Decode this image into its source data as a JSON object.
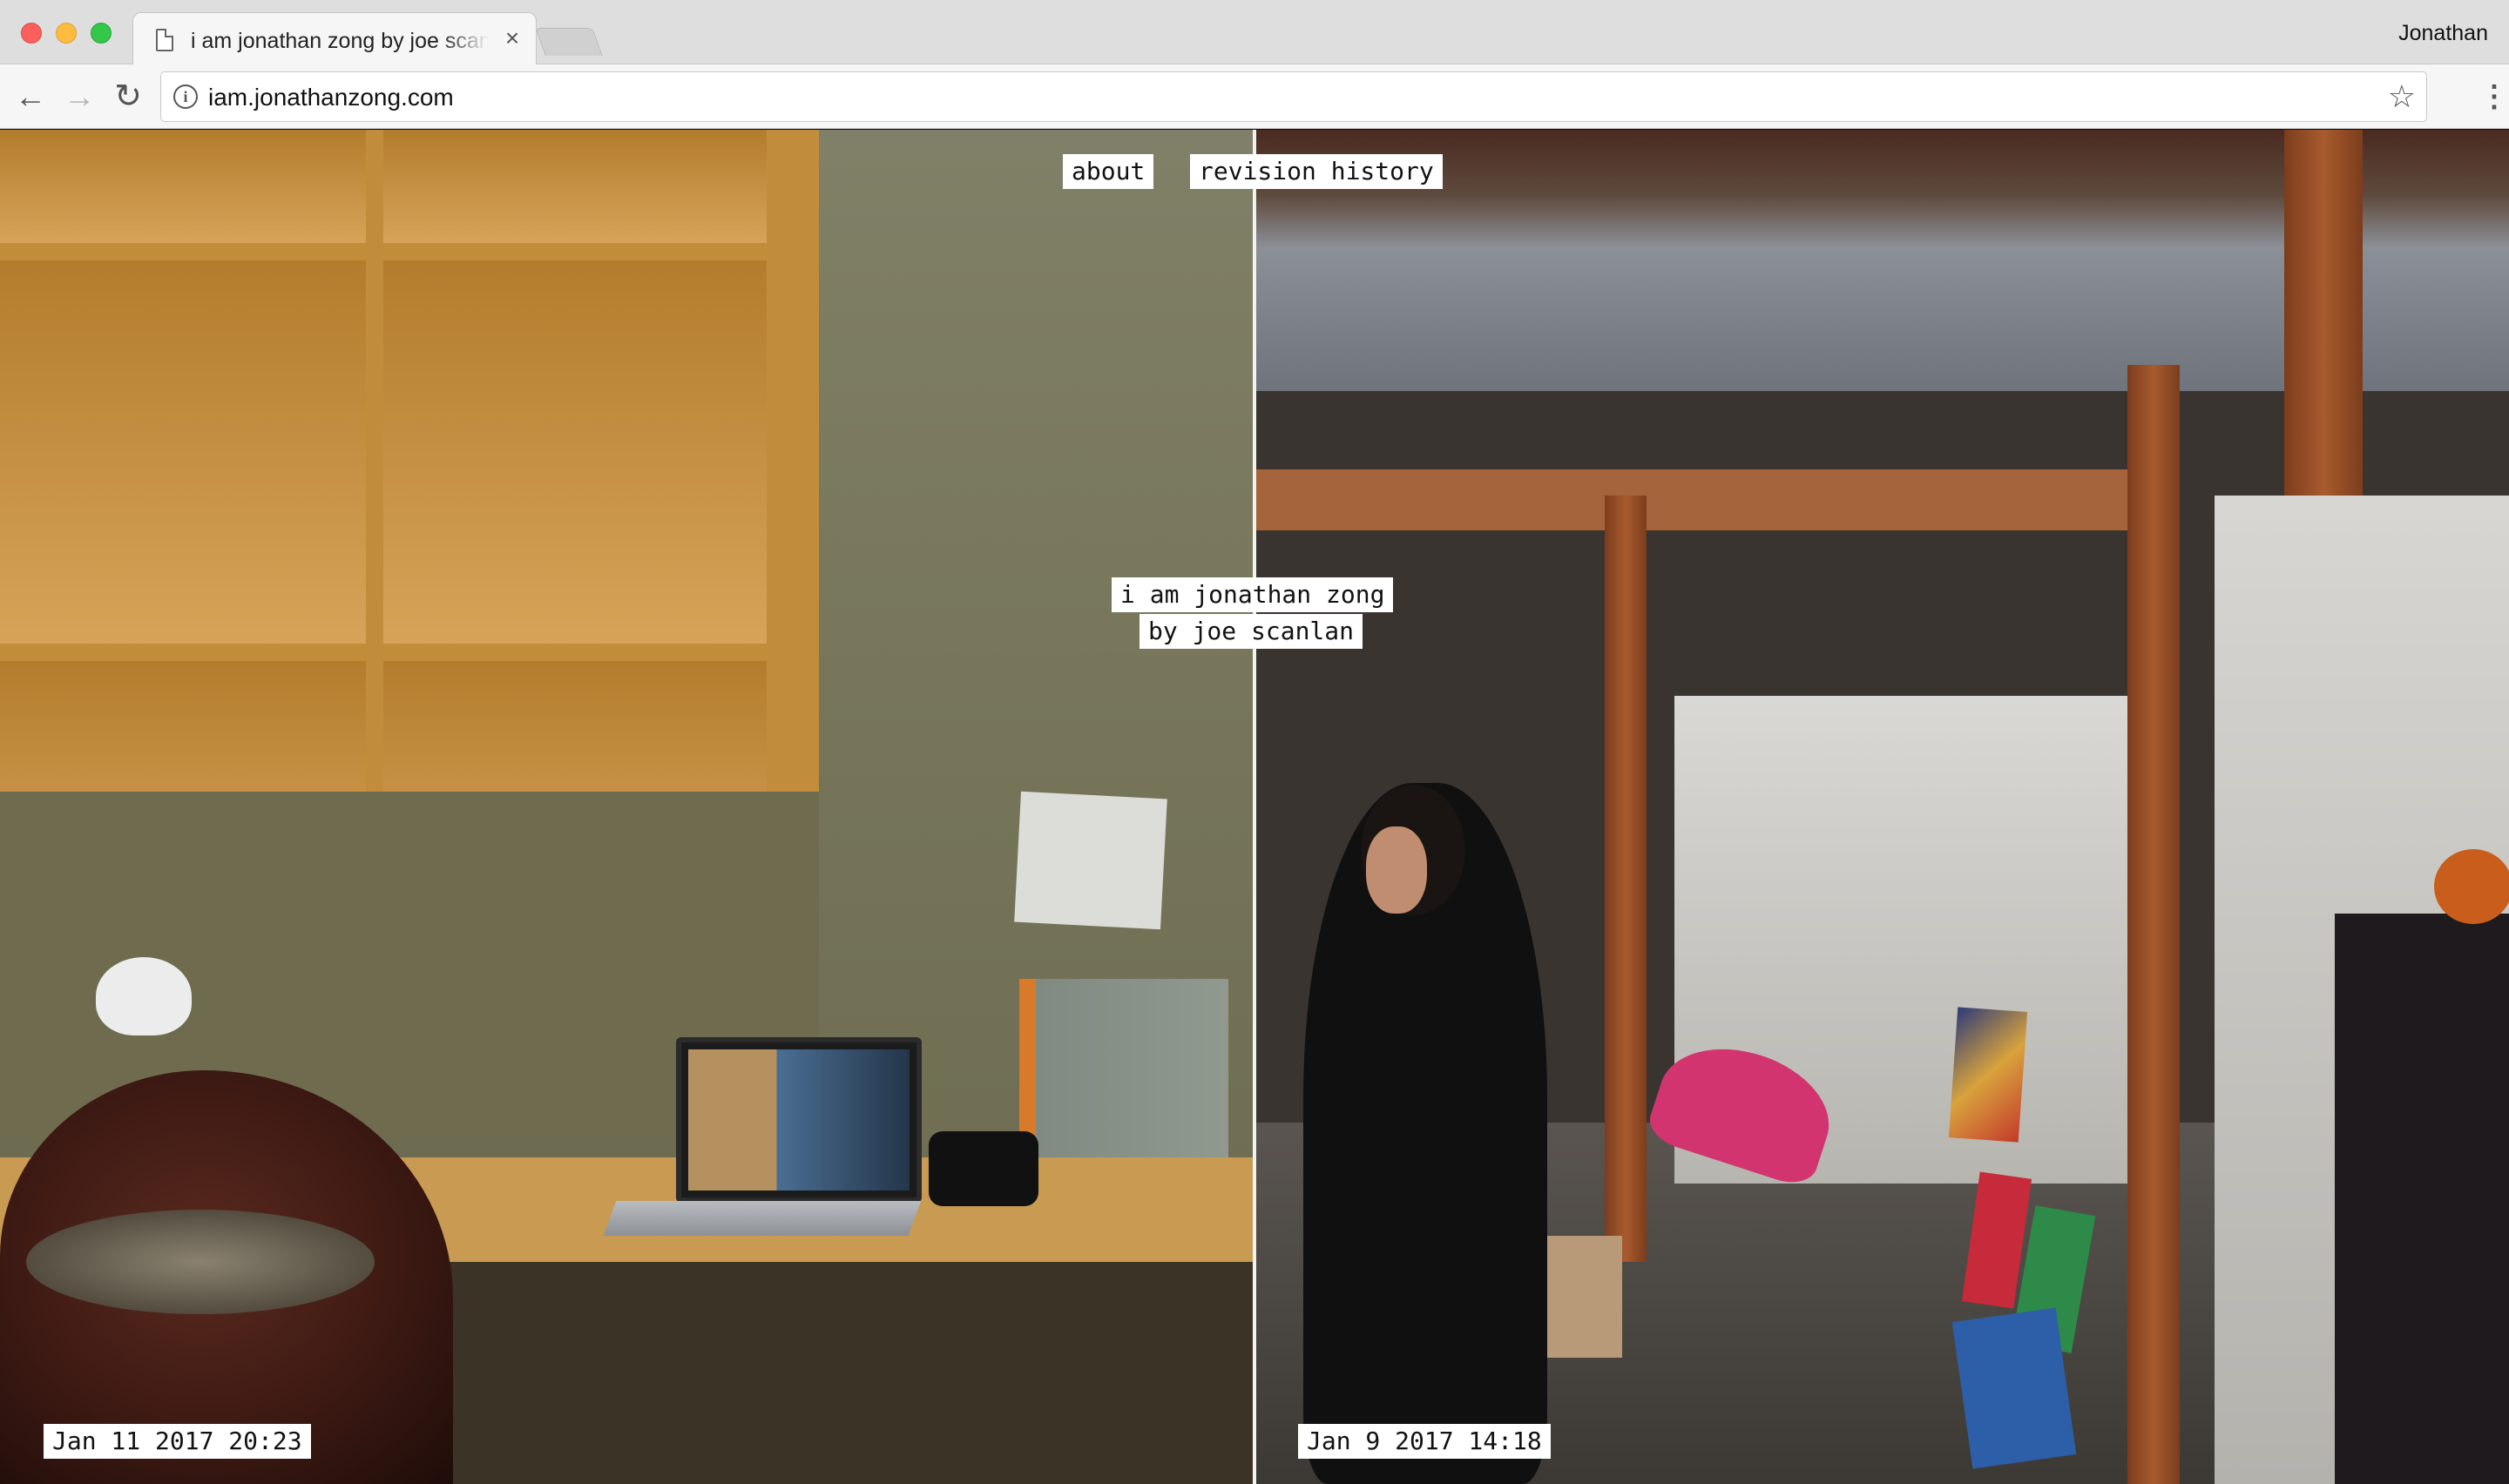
{
  "browser": {
    "tab_title": "i am jonathan zong by joe scanlan",
    "tab_close": "×",
    "profile_name": "Jonathan",
    "url": "iam.jonathanzong.com",
    "icons": {
      "back": "←",
      "forward": "→",
      "reload": "↻",
      "info": "i",
      "star": "☆",
      "menu": "⋮"
    }
  },
  "site": {
    "nav": {
      "about": "about",
      "revision_history": "revision history"
    },
    "title": {
      "line1": "i am jonathan zong",
      "line2": "by joe scanlan"
    },
    "timestamps": {
      "left": "Jan 11 2017 20:23",
      "right": "Jan 9 2017 14:18"
    }
  }
}
